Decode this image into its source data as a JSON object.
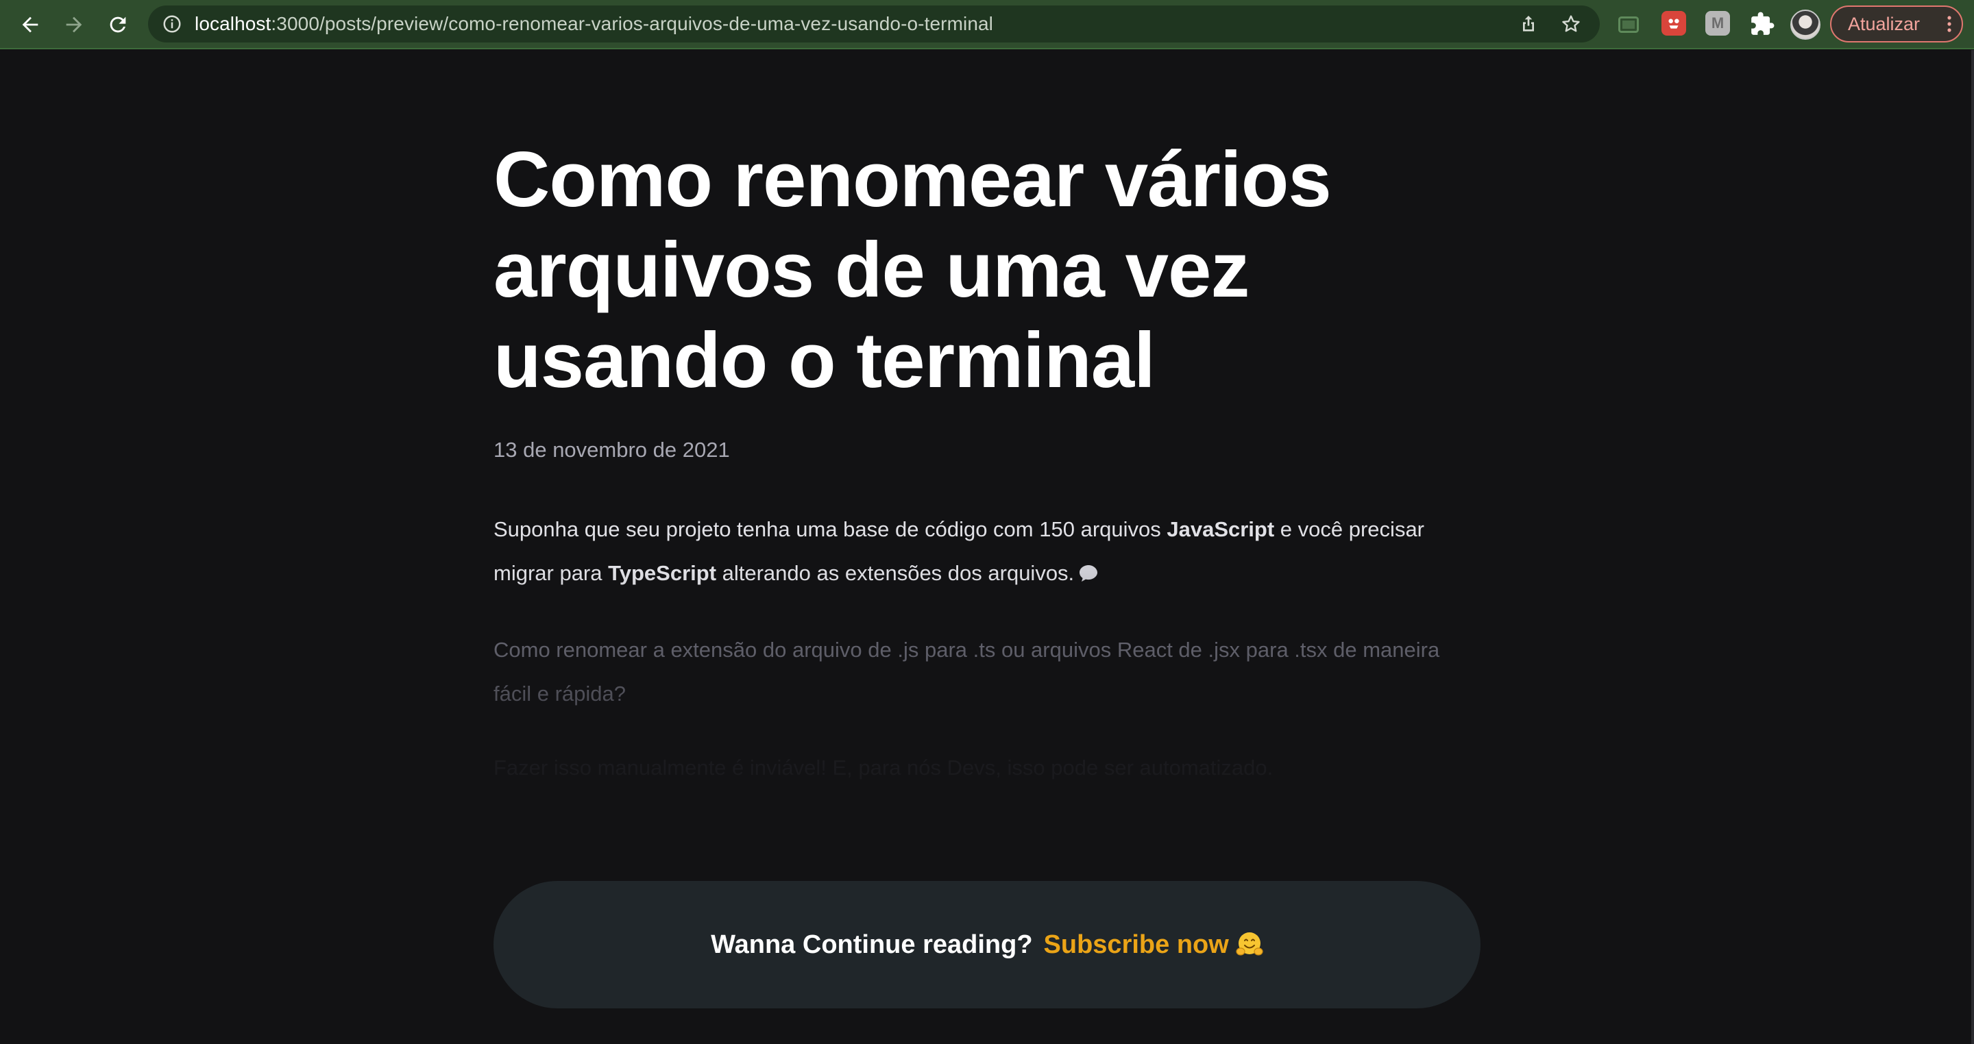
{
  "browser": {
    "url_host": "localhost",
    "url_rest": ":3000/posts/preview/como-renomear-varios-arquivos-de-uma-vez-usando-o-terminal",
    "update_label": "Atualizar",
    "icons": [
      "back-icon",
      "forward-icon",
      "reload-icon",
      "info-icon",
      "share-icon",
      "star-icon",
      "cast-icon",
      "extension-icon",
      "puzzle-icon",
      "kebab-menu-icon"
    ],
    "extensions": [
      {
        "name": "extension-red",
        "glyph": "",
        "color": "#d9453b"
      },
      {
        "name": "extension-m",
        "glyph": "M",
        "color": "#b7b7b7"
      }
    ],
    "colors": {
      "toolbar": "#2f4d2d",
      "update_border": "#e0776f"
    }
  },
  "post": {
    "title": "Como renomear vários arquivos de uma vez usando o terminal",
    "date": "13 de novembro de 2021",
    "p1": {
      "text_1": "Suponha que seu projeto tenha uma base de código com 150 arquivos ",
      "bold_1": "JavaScript",
      "text_2": " e você precisar migrar para ",
      "bold_2": "TypeScript",
      "text_3": " alterando as extensões dos arquivos."
    },
    "p2": "Como renomear a extensão do arquivo de .js para .ts ou arquivos React de .jsx para .tsx de maneira fácil e rápida?",
    "p3": "Fazer isso manualmente é inviável! E, para nós Devs, isso pode ser automatizado."
  },
  "cta": {
    "lead": "Wanna Continue reading?",
    "link": "Subscribe now",
    "emoji": "hugging-face-emoji",
    "colors": {
      "background": "#20262a",
      "link": "#eba417"
    }
  }
}
